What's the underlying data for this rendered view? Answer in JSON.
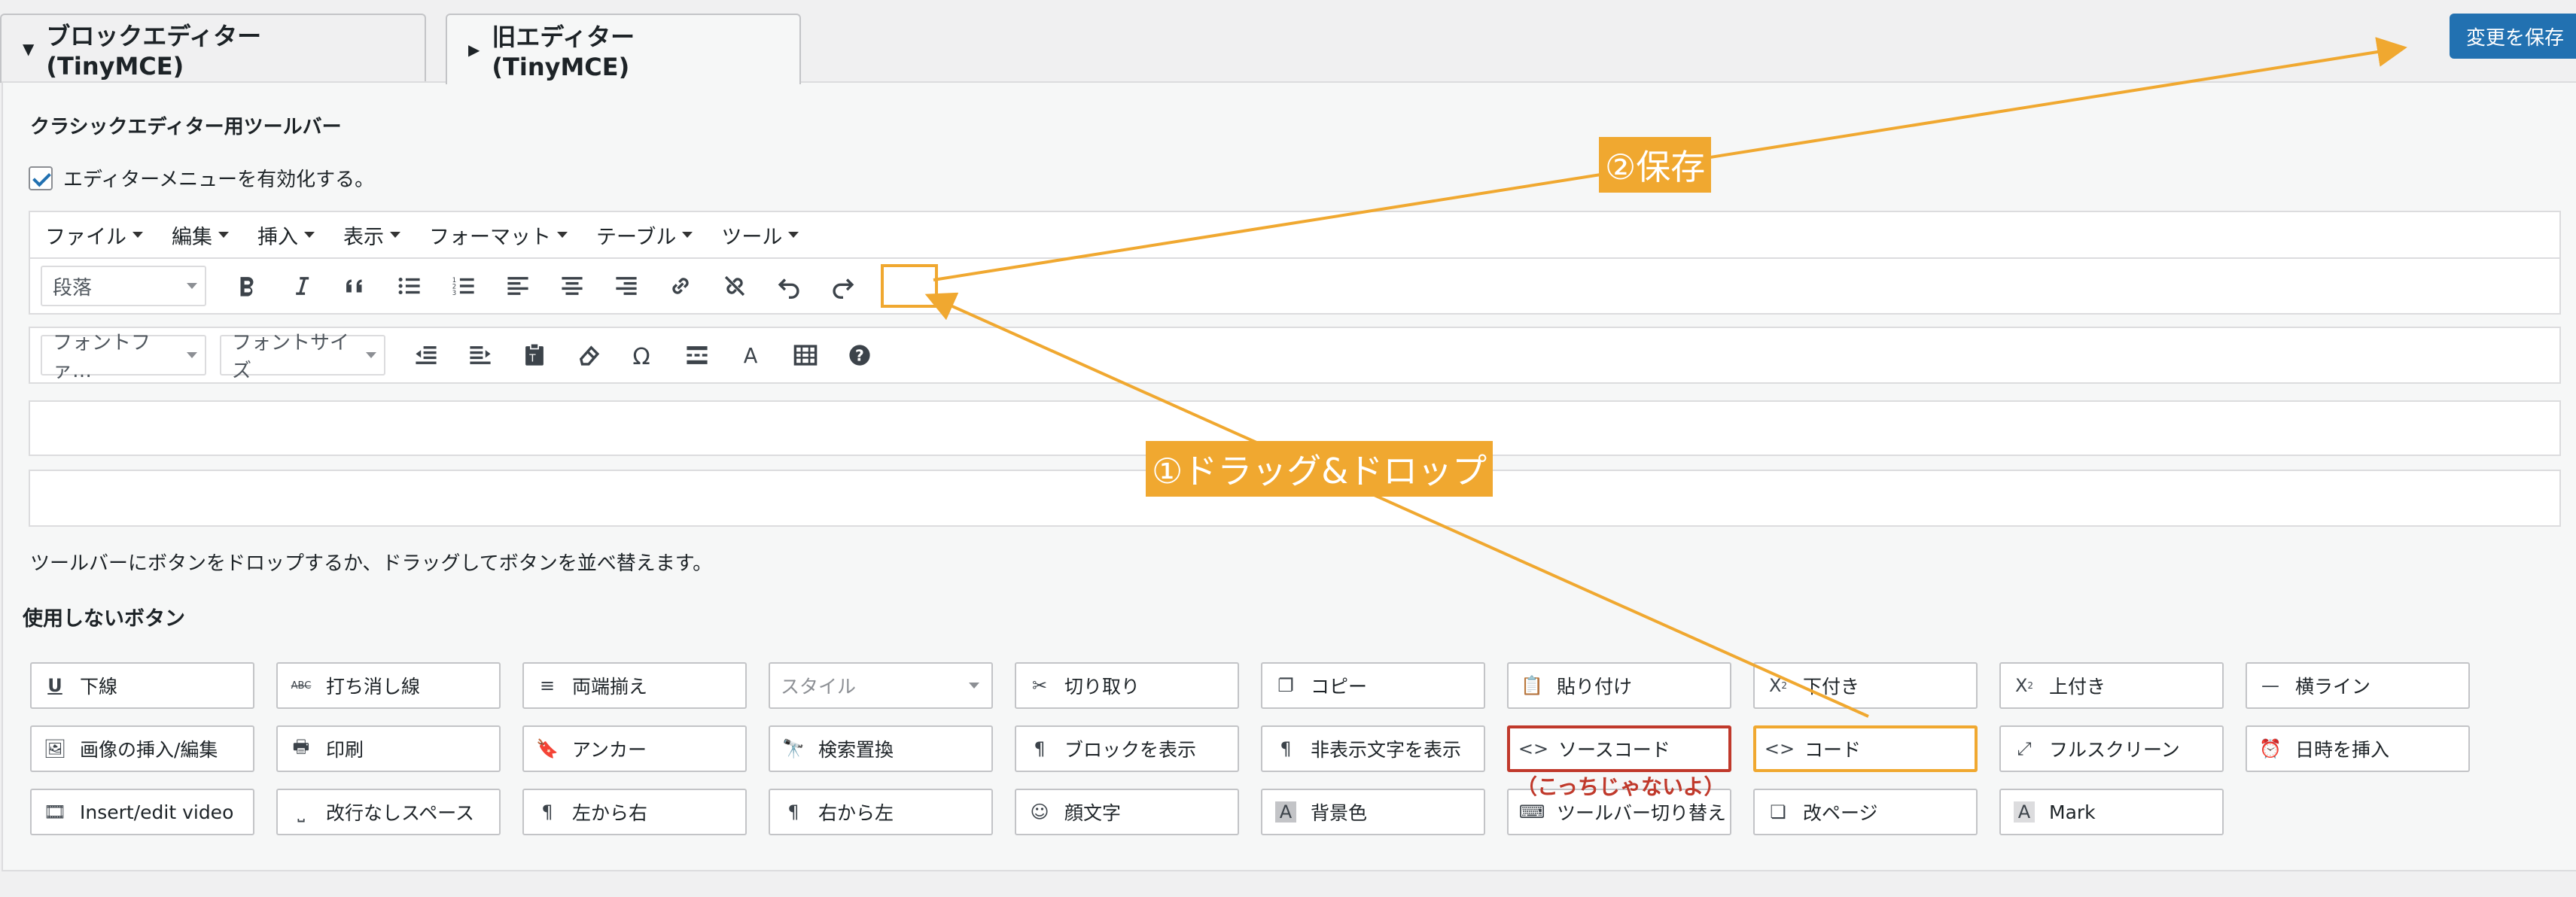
{
  "tabs": [
    {
      "label": "ブロックエディター (TinyMCE)",
      "caret": "▼"
    },
    {
      "label": "旧エディター (TinyMCE)",
      "caret": "▶"
    }
  ],
  "save_button": "変更を保存",
  "section_title": "クラシックエディター用ツールバー",
  "enable_menu_label": "エディターメニューを有効化する。",
  "menubar": [
    "ファイル",
    "編集",
    "挿入",
    "表示",
    "フォーマット",
    "テーブル",
    "ツール"
  ],
  "toolbar1": {
    "select": "段落",
    "icons": [
      "bold-icon",
      "italic-icon",
      "blockquote-icon",
      "bullet-list-icon",
      "numbered-list-icon",
      "align-left-icon",
      "align-center-icon",
      "align-right-icon",
      "link-icon",
      "unlink-icon",
      "undo-icon",
      "redo-icon"
    ]
  },
  "toolbar2": {
    "selects": [
      "フォントファ…",
      "フォントサイズ"
    ],
    "icons": [
      "outdent-icon",
      "indent-icon",
      "paste-text-icon",
      "clear-format-icon",
      "special-char-icon",
      "read-more-icon",
      "text-color-icon",
      "table-icon",
      "help-icon"
    ]
  },
  "help_text": "ツールバーにボタンをドロップするか、ドラッグしてボタンを並べ替えます。",
  "unused_title": "使用しないボタン",
  "unused_buttons": [
    [
      "下線",
      "打ち消し線",
      "両端揃え",
      "スタイル",
      "切り取り",
      "コピー",
      "貼り付け",
      "下付き",
      "上付き",
      "横ライン"
    ],
    [
      "画像の挿入/編集",
      "印刷",
      "アンカー",
      "検索置換",
      "ブロックを表示",
      "非表示文字を表示",
      "ソースコード",
      "コード",
      "フルスクリーン",
      "日時を挿入"
    ],
    [
      "Insert/edit video",
      "改行なしスペース",
      "左から右",
      "右から左",
      "顔文字",
      "背景色",
      "ツールバー切り替え",
      "改ページ",
      "Mark"
    ]
  ],
  "annotation": {
    "red_note": "（こっちじゃないよ）",
    "save_callout": "②保存",
    "drag_callout": "①ドラッグ&ドロップ",
    "color": "#f0a830",
    "red_color": "#c0392b"
  }
}
